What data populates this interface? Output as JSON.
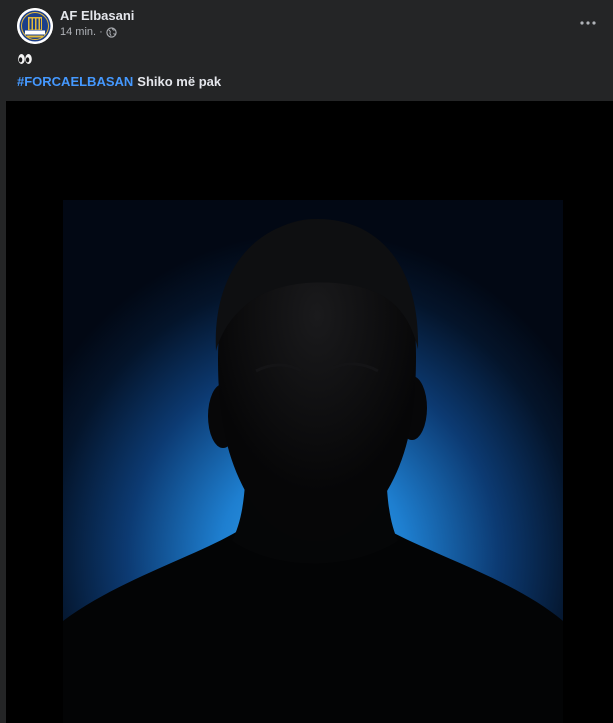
{
  "post": {
    "author": "AF Elbasani",
    "time": "14 min.",
    "separator": "·",
    "emoji_icon": "eyes-icon",
    "hashtag": "#FORCAELBASAN",
    "see_more": "Shiko më pak",
    "visibility_icon": "globe-icon",
    "more_icon": "more-horizontal-icon",
    "avatar_logo_text": "ELBASANI"
  },
  "colors": {
    "background": "#242526",
    "hashtag": "#4599ff",
    "text_primary": "#e4e6eb",
    "text_secondary": "#b0b3b8",
    "photo_backdrop": "#1e7fd0",
    "avatar_navy": "#1c3f8a",
    "avatar_gold": "#e2b93b"
  }
}
